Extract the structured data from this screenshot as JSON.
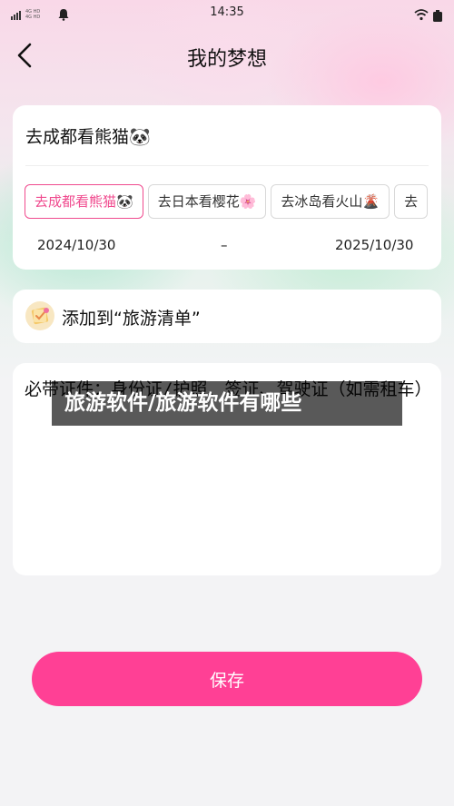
{
  "status_bar": {
    "time": "14:35",
    "network_line1": "4G HD",
    "network_line2": "4G HD"
  },
  "header": {
    "back_icon": "chevron-left-icon",
    "title": "我的梦想"
  },
  "dream_card": {
    "input_value": "去成都看熊猫🐼",
    "chips": [
      {
        "label": "去成都看熊猫🐼",
        "active": true
      },
      {
        "label": "去日本看樱花🌸",
        "active": false
      },
      {
        "label": "去冰岛看火山🌋",
        "active": false
      },
      {
        "label": "去",
        "active": false
      }
    ],
    "start_date": "2024/10/30",
    "date_separator": "–",
    "end_date": "2025/10/30"
  },
  "list_card": {
    "icon": "checklist-icon",
    "label": "添加到“旅游清单”"
  },
  "notes_card": {
    "text": "必带证件：身份证/护照、签证、驾驶证（如需租车）"
  },
  "watermark": {
    "text": "旅游软件/旅游软件有哪些"
  },
  "footer": {
    "save_label": "保存"
  },
  "colors": {
    "accent": "#ff4095",
    "chip_active": "#f04a8e"
  }
}
